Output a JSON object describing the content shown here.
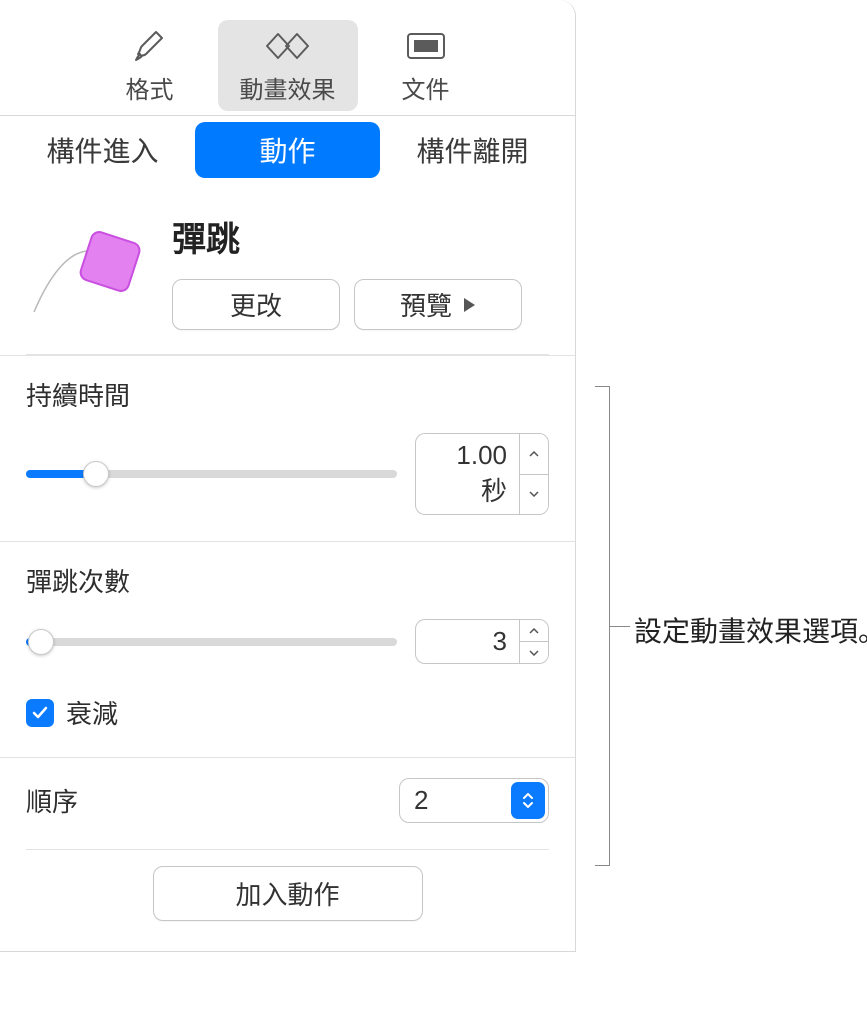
{
  "topTabs": {
    "format": "格式",
    "animate": "動畫效果",
    "document": "文件"
  },
  "subTabs": {
    "buildIn": "構件進入",
    "action": "動作",
    "buildOut": "構件離開"
  },
  "effect": {
    "title": "彈跳",
    "changeLabel": "更改",
    "previewLabel": "預覽"
  },
  "duration": {
    "label": "持續時間",
    "value": "1.00 秒",
    "sliderPercent": 19
  },
  "bounces": {
    "label": "彈跳次數",
    "value": "3",
    "sliderPercent": 4,
    "decayLabel": "衰減",
    "decayChecked": true
  },
  "order": {
    "label": "順序",
    "value": "2"
  },
  "addActionLabel": "加入動作",
  "callout": "設定動畫效果選項。"
}
